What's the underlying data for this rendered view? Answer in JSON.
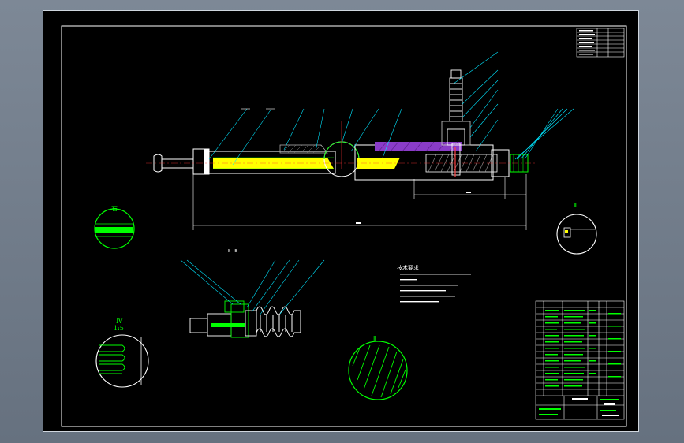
{
  "sheet": {
    "background": "#000000",
    "border": "#ffffff"
  },
  "labels": {
    "detail_upper_left": "右",
    "detail_upper_right": "Ⅲ",
    "detail_lower_left_roman": "Ⅳ",
    "detail_lower_left_scale": "1:5",
    "detail_lower_center": "Ⅱ",
    "section_view": "B—B",
    "tech_req_title": "技术要求"
  },
  "colors": {
    "line_white": "#ffffff",
    "line_green": "#00ff00",
    "leader_cyan": "#00e5ff",
    "fill_yellow": "#ffff00",
    "fill_purple": "#8a3cc8",
    "hatch_gray": "#9a9a9a"
  }
}
